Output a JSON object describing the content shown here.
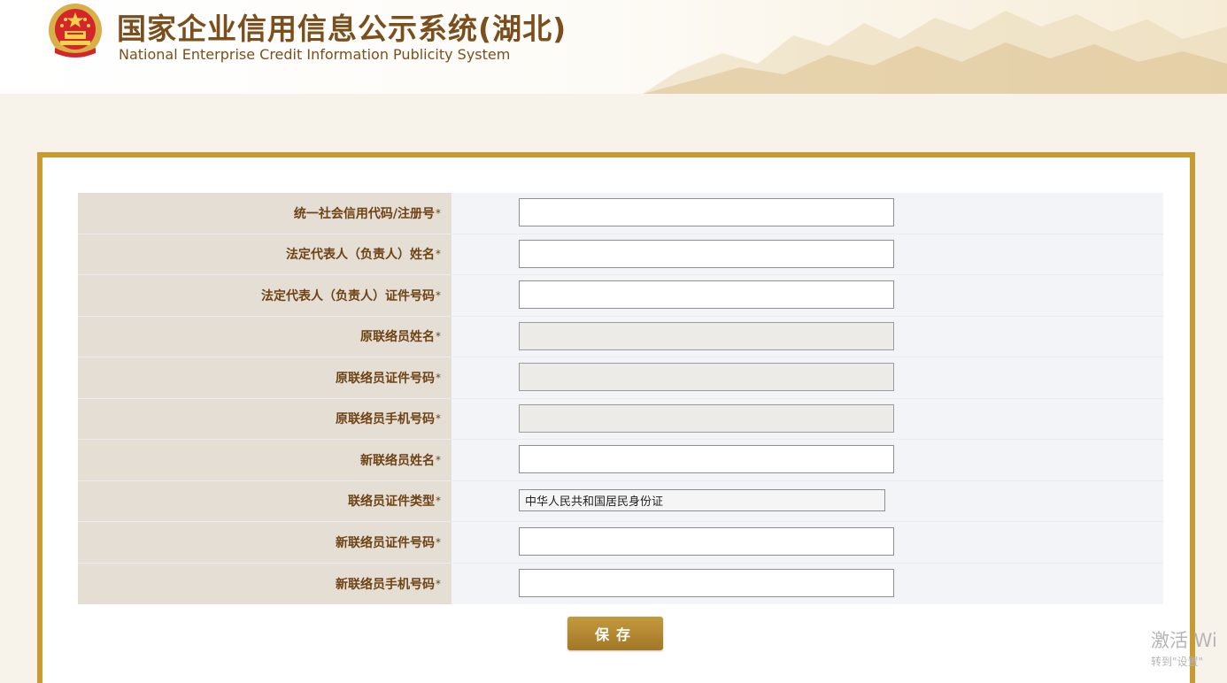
{
  "header": {
    "title_cn": "国家企业信用信息公示系统(湖北)",
    "title_en": "National Enterprise Credit Information Publicity System"
  },
  "form": {
    "rows": [
      {
        "label": "统一社会信用代码/注册号",
        "required": "*",
        "type": "input",
        "value": ""
      },
      {
        "label": "法定代表人（负责人）姓名",
        "required": "*",
        "type": "input",
        "value": ""
      },
      {
        "label": "法定代表人（负责人）证件号码",
        "required": "*",
        "type": "input",
        "value": ""
      },
      {
        "label": "原联络员姓名",
        "required": "*",
        "type": "disabled",
        "value": ""
      },
      {
        "label": "原联络员证件号码",
        "required": "*",
        "type": "disabled",
        "value": ""
      },
      {
        "label": "原联络员手机号码",
        "required": "*",
        "type": "disabled",
        "value": ""
      },
      {
        "label": "新联络员姓名",
        "required": "*",
        "type": "input",
        "value": ""
      },
      {
        "label": "联络员证件类型",
        "required": "*",
        "type": "select",
        "value": "中华人民共和国居民身份证"
      },
      {
        "label": "新联络员证件号码",
        "required": "*",
        "type": "input",
        "value": ""
      },
      {
        "label": "新联络员手机号码",
        "required": "*",
        "type": "input",
        "value": ""
      }
    ],
    "save_label": "保存"
  },
  "watermark": {
    "line1": "激活 Wi",
    "line2": "转到\"设置\""
  },
  "colors": {
    "brand_brown": "#7a4f1d",
    "panel_border": "#c89b32",
    "label_background": "#e5ded5",
    "button": "#b08a35"
  },
  "icons": {
    "emblem": "national-emblem-icon"
  }
}
